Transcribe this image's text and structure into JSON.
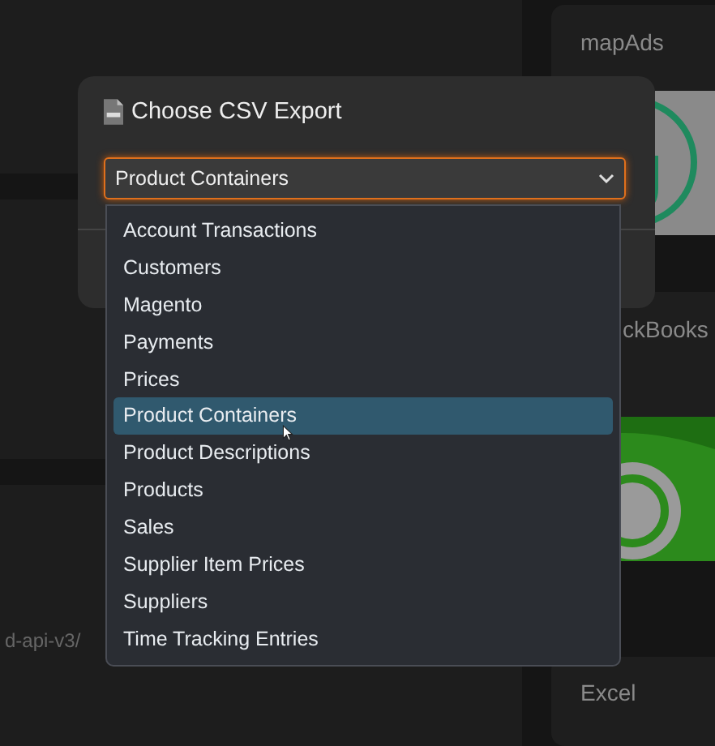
{
  "background": {
    "left_text": "d-api-v3/",
    "right_cards": [
      {
        "title": "mapAds",
        "kind": "ring"
      },
      {
        "title": "ckBooks",
        "kind": "disc"
      },
      {
        "title": "Excel",
        "kind": "none"
      }
    ]
  },
  "dialog": {
    "title": "Choose CSV Export",
    "select": {
      "value": "Product Containers"
    },
    "options": [
      {
        "label": "Account Transactions",
        "selected": false
      },
      {
        "label": "Customers",
        "selected": false
      },
      {
        "label": "Magento",
        "selected": false
      },
      {
        "label": "Payments",
        "selected": false
      },
      {
        "label": "Prices",
        "selected": false
      },
      {
        "label": "Product Containers",
        "selected": true
      },
      {
        "label": "Product Descriptions",
        "selected": false
      },
      {
        "label": "Products",
        "selected": false
      },
      {
        "label": "Sales",
        "selected": false
      },
      {
        "label": "Supplier Item Prices",
        "selected": false
      },
      {
        "label": "Suppliers",
        "selected": false
      },
      {
        "label": "Time Tracking Entries",
        "selected": false
      }
    ]
  }
}
